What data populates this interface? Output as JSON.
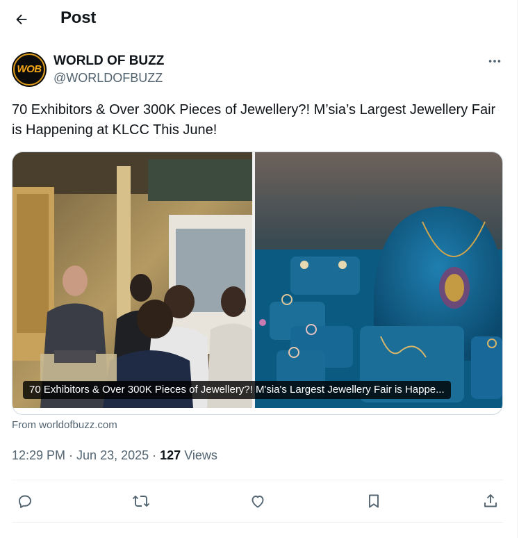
{
  "header": {
    "title": "Post",
    "back_icon": "arrow-left-icon"
  },
  "author": {
    "display_name": "WORLD OF BUZZ",
    "handle": "@WORLDOFBUZZ",
    "avatar_text": "WOB",
    "avatar_colors": {
      "background": "#0b0b0b",
      "accent": "#f3a516"
    }
  },
  "post": {
    "text": "70 Exhibitors & Over 300K Pieces of Jewellery?! M’sia’s Largest Jewellery Fair is Happening at KLCC This June!"
  },
  "link_card": {
    "caption": "70 Exhibitors & Over 300K Pieces of Jewellery?! M'sia's Largest Jewellery Fair is Happe...",
    "source": "From worldofbuzz.com"
  },
  "meta": {
    "time": "12:29 PM",
    "date": "Jun 23, 2025",
    "views_count": "127",
    "views_label": "Views"
  },
  "actions": [
    "reply-icon",
    "repost-icon",
    "like-icon",
    "bookmark-icon",
    "share-icon"
  ],
  "colors": {
    "text_primary": "#0f1419",
    "text_secondary": "#536471",
    "border": "#cfd9de",
    "divider": "#eff3f4",
    "icon": "#536471"
  }
}
